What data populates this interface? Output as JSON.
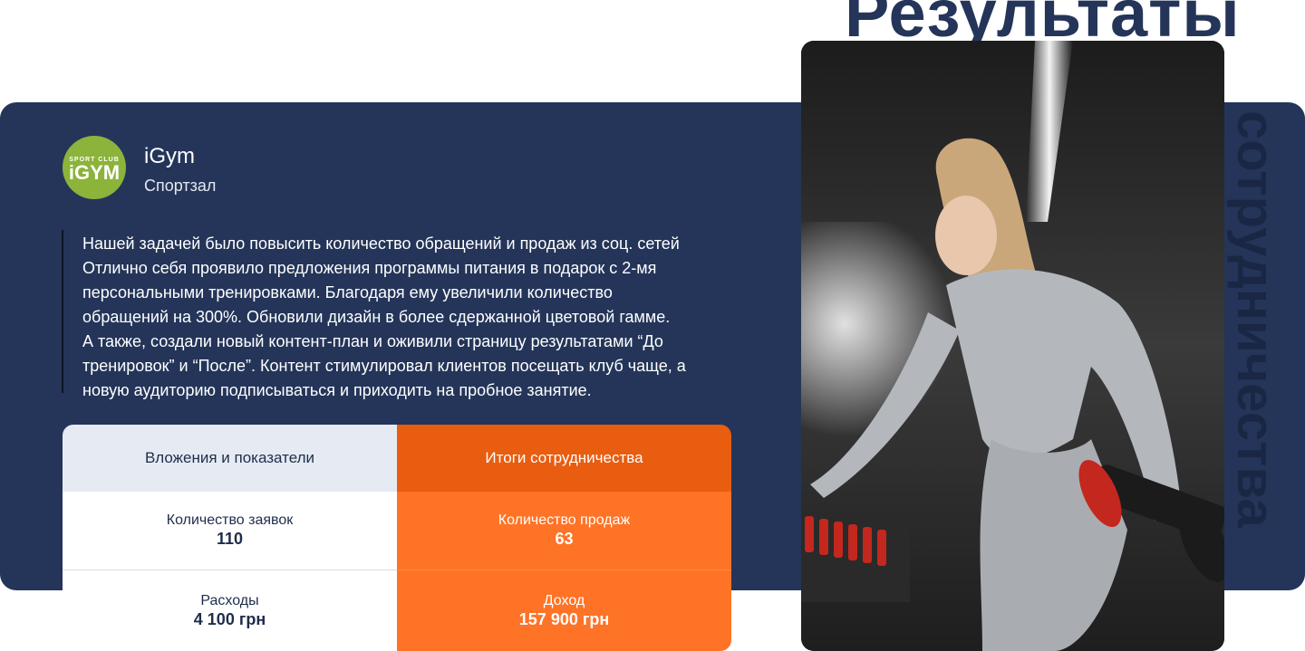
{
  "header": {
    "title": "Результаты",
    "vertical_title": "сотрудничества"
  },
  "company": {
    "logo_small": "SPORT CLUB",
    "logo_big": "iGYM",
    "name": "iGym",
    "type": "Спортзал"
  },
  "description": [
    "Нашей задачей было повысить количество обращений и продаж из соц. сетей",
    "Отлично себя проявило предложения программы питания в подарок с 2-мя",
    "персональными тренировками. Благодаря ему увеличили количество",
    "обращений на 300%.  Обновили дизайн в более сдержанной цветовой гамме.",
    "А также, создали новый контент-план и оживили страницу результатами “До",
    "тренировок” и “После”. Контент стимулировал клиентов посещать клуб чаще, а",
    "новую аудиторию подписываться и приходить на пробное занятие."
  ],
  "table": {
    "left_header": "Вложения и показатели",
    "right_header": "Итоги сотрудничества",
    "rows": [
      {
        "left_label": "Количество заявок",
        "left_value": "110",
        "right_label": "Количество продаж",
        "right_value": "63"
      },
      {
        "left_label": "Расходы",
        "left_value": "4 100 грн",
        "right_label": "Доход",
        "right_value": "157 900 грн"
      }
    ]
  },
  "colors": {
    "navy": "#243559",
    "orange_dark": "#e85d10",
    "orange": "#ff7326",
    "logo_green": "#8cb33a"
  }
}
